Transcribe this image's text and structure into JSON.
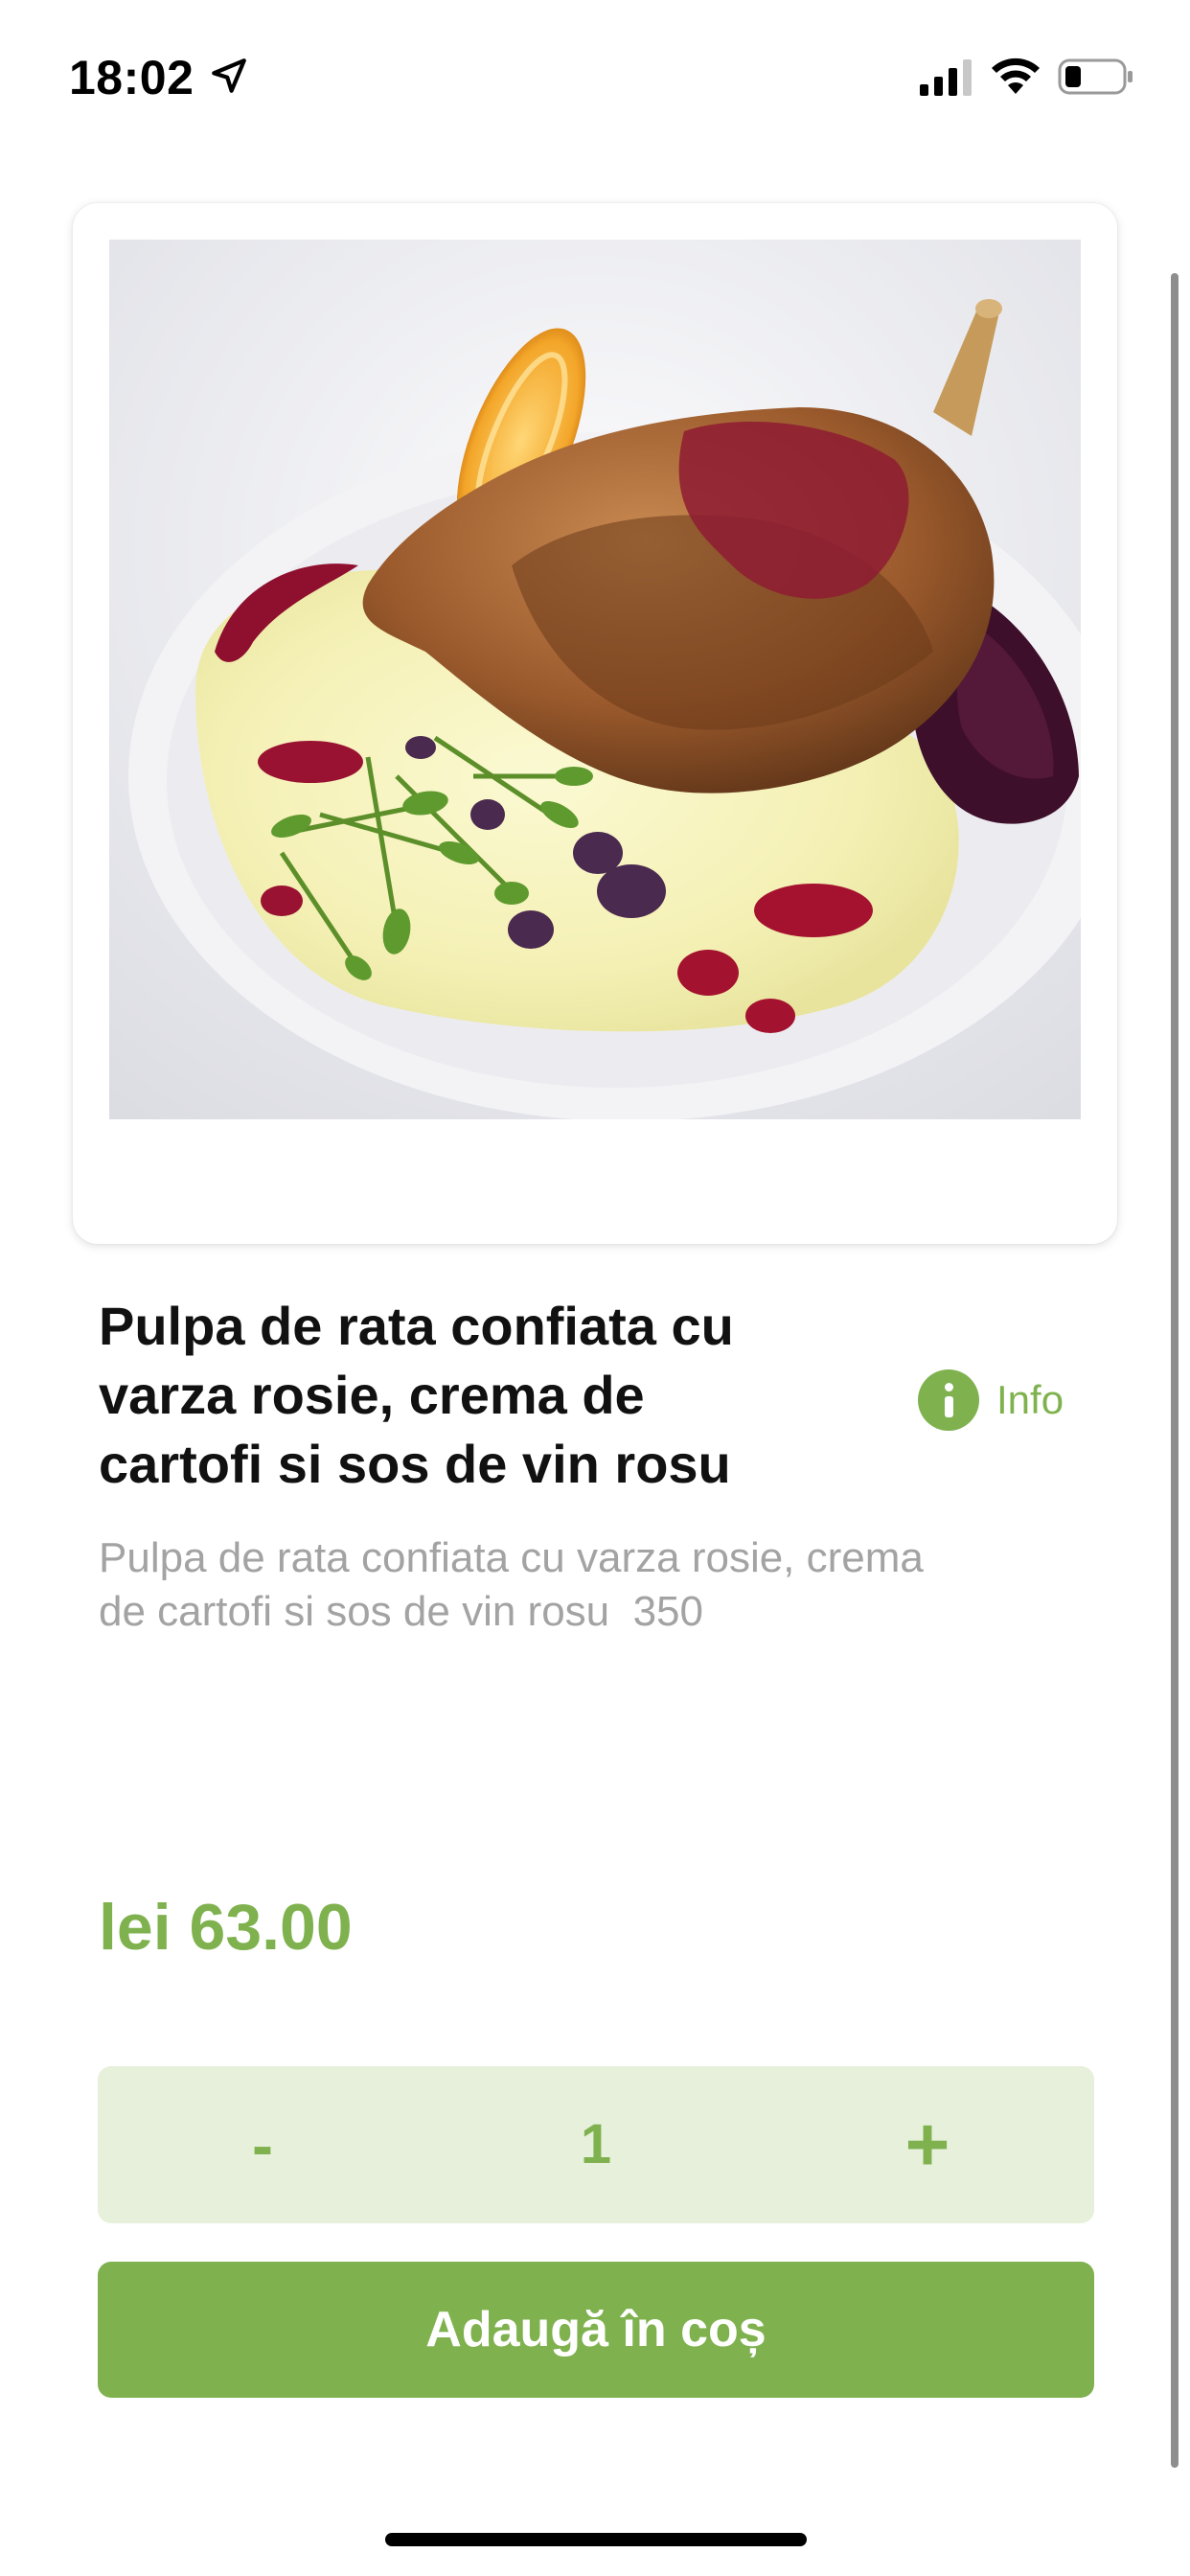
{
  "status_bar": {
    "time": "18:02",
    "icons": [
      "location-arrow-icon",
      "cellular-signal-icon",
      "wifi-icon",
      "battery-icon"
    ]
  },
  "product": {
    "image_alt": "confit duck leg with red cabbage, potato cream and red wine sauce",
    "title": "Pulpa de rata confiata cu varza rosie, crema de cartofi si sos de vin rosu",
    "title_lines": [
      "Pulpa de rata confiata cu",
      "varza rosie, crema de",
      "cartofi si sos de vin rosu"
    ],
    "description": "Pulpa de rata confiata cu varza rosie, crema de cartofi si sos de vin rosu  350",
    "description_lines": [
      "Pulpa de rata confiata cu varza rosie, crema",
      "de cartofi si sos de vin rosu  350"
    ],
    "price": "lei 63.00"
  },
  "info_button": {
    "label": "Info",
    "icon": "info-circle-icon"
  },
  "quantity": {
    "minus_label": "-",
    "value": "1",
    "plus_label": "+"
  },
  "add_to_cart": {
    "label": "Adaugă în coș"
  },
  "colors": {
    "accent": "#7fb24f",
    "accent_light": "#e6f0da",
    "title_text": "#111111",
    "description_text": "#a3a3a3"
  }
}
